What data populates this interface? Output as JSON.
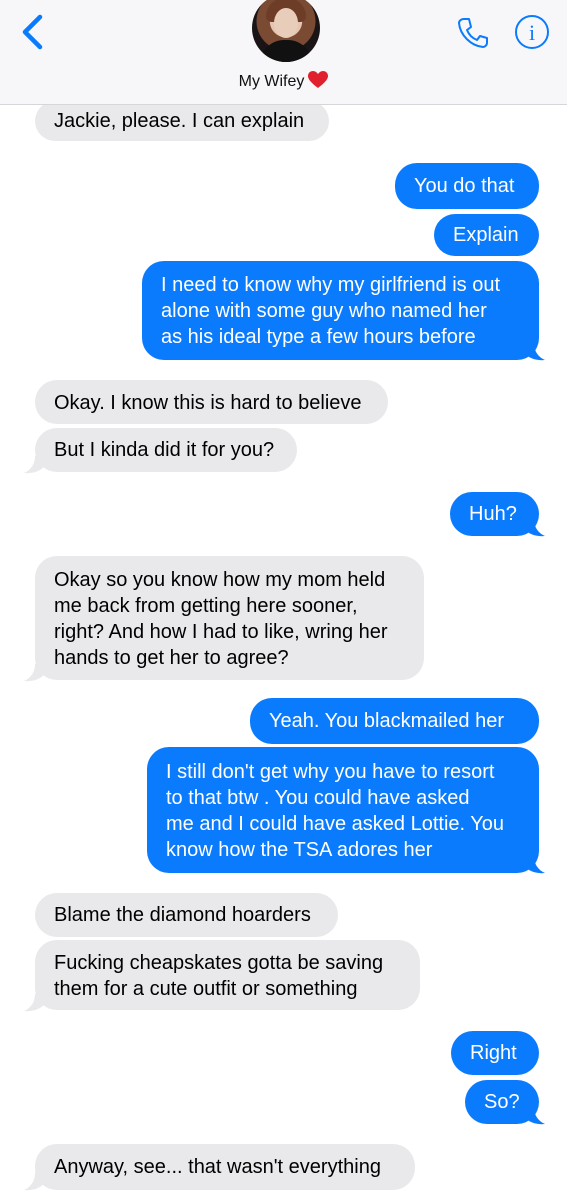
{
  "header": {
    "contact_name": "My Wifey",
    "icons": [
      "back-chevron-icon",
      "phone-icon",
      "info-icon",
      "heart-emoji"
    ]
  },
  "colors": {
    "outgoing": "#0b7bfd",
    "incoming": "#e9e9eb",
    "accent": "#0b7bfd"
  },
  "messages": [
    {
      "from": "them",
      "lines": [
        "Jackie, please. I can explain"
      ]
    },
    {
      "from": "me",
      "lines": [
        "You do that"
      ]
    },
    {
      "from": "me",
      "lines": [
        "Explain"
      ]
    },
    {
      "from": "me",
      "lines": [
        "I need to know why my girlfriend is out",
        "alone with some guy who named her",
        "as his ideal type a few hours before"
      ]
    },
    {
      "from": "them",
      "lines": [
        "Okay. I know this is hard to believe"
      ]
    },
    {
      "from": "them",
      "lines": [
        "But I kinda did it for you?"
      ]
    },
    {
      "from": "me",
      "lines": [
        "Huh?"
      ]
    },
    {
      "from": "them",
      "lines": [
        "Okay so you know how my mom held",
        "me back from getting here sooner,",
        "right? And how I had to like, wring her",
        "hands to get her to agree?"
      ]
    },
    {
      "from": "me",
      "lines": [
        "Yeah. You blackmailed her"
      ]
    },
    {
      "from": "me",
      "lines": [
        "I still don't get why you have to resort",
        "to that btw . You could have asked",
        "me and I could have asked Lottie. You",
        "know how the TSA adores her"
      ]
    },
    {
      "from": "them",
      "lines": [
        "Blame the diamond hoarders"
      ]
    },
    {
      "from": "them",
      "lines": [
        "Fucking cheapskates gotta be saving",
        "them for a cute outfit or something"
      ]
    },
    {
      "from": "me",
      "lines": [
        "Right"
      ]
    },
    {
      "from": "me",
      "lines": [
        "So?"
      ]
    },
    {
      "from": "them",
      "lines": [
        "Anyway, see... that wasn't everything"
      ]
    }
  ]
}
